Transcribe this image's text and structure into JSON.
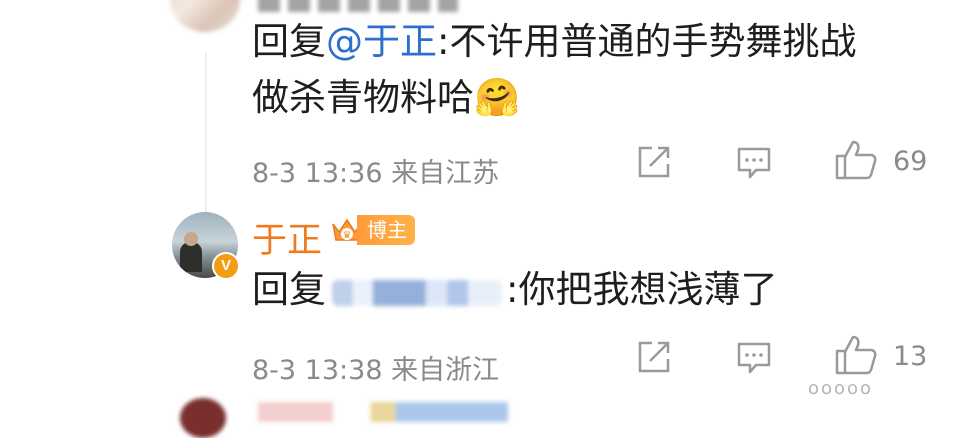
{
  "comment1": {
    "reply_prefix": "回复",
    "mention": "@于正",
    "text_line1_rest": ":不许用普通的手势舞挑战",
    "text_line2": "做杀青物料哈",
    "emoji": "🤗",
    "meta": "8-3 13:36 来自江苏",
    "like_count": "69"
  },
  "comment2": {
    "author": "于正",
    "badge": "博主",
    "verified": "V",
    "reply_prefix": "回复",
    "text": ":你把我想浅薄了",
    "meta": "8-3 13:38 来自浙江",
    "like_count": "13"
  },
  "watermark": "ooooo",
  "icons": {
    "share": "share-icon",
    "comment": "comment-icon",
    "like": "thumbs-up-icon"
  },
  "colors": {
    "mention": "#2d6fcf",
    "author": "#f07a1e",
    "meta": "#8a8a8a",
    "badge": "#ff9a3c"
  }
}
